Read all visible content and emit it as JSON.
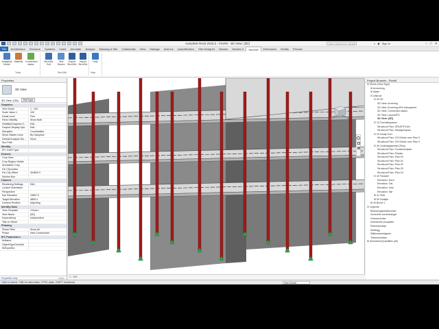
{
  "window": {
    "title": "Autodesk Revit 2018.2 - Fire#6 - 3D View: {3D}",
    "search_placeholder": "Type a keyword or phrase",
    "user": "Sign In",
    "controls": [
      "–",
      "□",
      "✕"
    ]
  },
  "tabs": [
    "File",
    "Architecture",
    "Structure",
    "Systems",
    "Insert",
    "Annotate",
    "Analyze",
    "Massing & Site",
    "Collaborate",
    "View",
    "Manage",
    "Add-Ins",
    "Quantification",
    "Site Designer",
    "Navisto",
    "Navisto 3",
    "StruSoft",
    "Extensions",
    "Modify",
    "Precast"
  ],
  "active_tab": "StruSoft",
  "ribbon": {
    "buttons": [
      {
        "label": "Analytical Model",
        "icon": "analytical-model-icon",
        "color": "#4a7fc1"
      },
      {
        "label": "Material",
        "icon": "material-icon",
        "color": "#c97a3a"
      },
      {
        "label": "Connection status",
        "icon": "connection-status-icon",
        "color": "#6aa84f"
      },
      {
        "label": "StruXML Exit",
        "icon": "struxml-exit-icon",
        "color": "#3d6fb0"
      },
      {
        "label": "Grid Search",
        "icon": "grid-search-icon",
        "color": "#5b8fd0"
      },
      {
        "label": "Export StruXML",
        "icon": "export-struxml-icon",
        "color": "#2f5f9e"
      },
      {
        "label": "Import StruXML",
        "icon": "import-struxml-icon",
        "color": "#2f5f9e"
      },
      {
        "label": "Help",
        "icon": "help-icon",
        "color": "#3b78c4"
      }
    ],
    "panels": [
      "Tools",
      "StruXML",
      "Help"
    ]
  },
  "properties": {
    "title": "Properties",
    "type_name": "3D View",
    "filter_value": "3D View: {3D}",
    "edit_type": "Edit Type",
    "groups": [
      {
        "name": "Graphics",
        "rows": [
          [
            "View Scale",
            "1 : 100"
          ],
          [
            "Scale Value  1:",
            "100"
          ],
          [
            "Detail Level",
            "Fine"
          ],
          [
            "Parts Visibility",
            "Show Both"
          ],
          [
            "Visibility/Graphics O...",
            "Edit..."
          ],
          [
            "Graphic Display Opti...",
            "Edit..."
          ],
          [
            "Discipline",
            "Coordination"
          ],
          [
            "Show Hidden Lines",
            "By Discipline"
          ],
          [
            "Default Analysis Dis...",
            "None"
          ],
          [
            "Sun Path",
            ""
          ]
        ]
      },
      {
        "name": "Identity",
        "rows": [
          [
            "IFC GUID Type",
            ""
          ]
        ]
      },
      {
        "name": "Extents",
        "rows": [
          [
            "Crop View",
            ""
          ],
          [
            "Crop Region Visible",
            ""
          ],
          [
            "Annotation Crop",
            ""
          ],
          [
            "Far Clip Active",
            ""
          ],
          [
            "Far Clip Offset",
            "304800.0"
          ],
          [
            "Section Box",
            ""
          ]
        ]
      },
      {
        "name": "Camera",
        "rows": [
          [
            "Rendering Settings",
            "Edit..."
          ],
          [
            "Locked Orientation",
            ""
          ],
          [
            "Perspective",
            ""
          ],
          [
            "Eye Elevation",
            "15807.0"
          ],
          [
            "Target Elevation",
            "4850.4"
          ],
          [
            "Camera Position",
            "Adjusting"
          ]
        ]
      },
      {
        "name": "Identity Data",
        "rows": [
          [
            "View Template",
            "<None>"
          ],
          [
            "View Name",
            "{3D}"
          ],
          [
            "Dependency",
            "Independent"
          ],
          [
            "Title on Sheet",
            ""
          ]
        ]
      },
      {
        "name": "Phasing",
        "rows": [
          [
            "Phase Filter",
            "Show All"
          ],
          [
            "Phase",
            "New Construction"
          ]
        ]
      },
      {
        "name": "IFC Parameters",
        "rows": [
          [
            "IfcName",
            ""
          ],
          [
            "ObjectTypeOverride",
            ""
          ],
          [
            "IfcExportAs",
            ""
          ]
        ]
      }
    ],
    "help_link": "Properties help",
    "apply": "Apply"
  },
  "browser": {
    "title": "Project Browser - Fire#6",
    "items": [
      {
        "t": "⊟ Views (View Type)",
        "d": 0
      },
      {
        "t": "⊞ Avmerking",
        "d": 1
      },
      {
        "t": "⊞ Mater",
        "d": 1
      },
      {
        "t": "⊟ Utstruct",
        "d": 1
      },
      {
        "t": "⊟ 00 3D",
        "d": 2
      },
      {
        "t": "3D View: Armering",
        "d": 3
      },
      {
        "t": "3D View: Armering 60% transparent",
        "d": 3
      },
      {
        "t": "3D View: Connection status",
        "d": 3
      },
      {
        "t": "3D View: Layout3PC",
        "d": 3
      },
      {
        "t": "3D View: {3D}",
        "d": 3,
        "sel": true
      },
      {
        "t": "⊟ 10 Oversiktsplaner",
        "d": 2
      },
      {
        "t": "Structural Plan: GRUNTPLAN",
        "d": 3
      },
      {
        "t": "Structural Plan: Situasjonsplan",
        "d": 3
      },
      {
        "t": "⊟ 20 Detalj Over",
        "d": 2
      },
      {
        "t": "Structural Plan: 120 Dekke over Plan 0",
        "d": 3
      },
      {
        "t": "Structural Plan: 220 Dekke over Plan 0",
        "d": 3
      },
      {
        "t": "⊟ 30 Underlagsarbeid (Plan)",
        "d": 2
      },
      {
        "t": "Structural Plan: Fundamentplan",
        "d": 3
      },
      {
        "t": "Structural Plan: Pelplan",
        "d": 3
      },
      {
        "t": "Structural Plan: Plan 00",
        "d": 3
      },
      {
        "t": "Structural Plan: Plan 01",
        "d": 3
      },
      {
        "t": "Structural Plan: Plan 02",
        "d": 3
      },
      {
        "t": "Structural Plan: Plan 03",
        "d": 3
      },
      {
        "t": "Structural Plan: Plan 04",
        "d": 3
      },
      {
        "t": "⊟ 40 Fasader",
        "d": 2
      },
      {
        "t": "Elevation: Nord",
        "d": 3
      },
      {
        "t": "Elevation: Ost",
        "d": 3
      },
      {
        "t": "Elevation: Vest",
        "d": 3
      },
      {
        "t": "Elevation: Sør",
        "d": 3
      },
      {
        "t": "⊞ 41 Snitt",
        "d": 2
      },
      {
        "t": "⊞ 50 Detaljer",
        "d": 2
      },
      {
        "t": "⊞ Vil Burde 1",
        "d": 1
      },
      {
        "t": "⊟ Legends",
        "d": 0
      },
      {
        "t": "Belastningsbeskrivelser",
        "d": 1
      },
      {
        "t": "Generelle anmerkninger",
        "d": 1
      },
      {
        "t": "Grenseverdier",
        "d": 1
      },
      {
        "t": "Innledende prosjekter",
        "d": 1
      },
      {
        "t": "Pelbeskrivelse",
        "d": 1
      },
      {
        "t": "Skiltlegg",
        "d": 1
      },
      {
        "t": "Stålbeskrivelsjøner",
        "d": 1
      },
      {
        "t": "Trebeskrivelser",
        "d": 1
      },
      {
        "t": "⊞ Schedules/Quantities (all)",
        "d": 0
      }
    ]
  },
  "view_control": "1 : 100",
  "status": {
    "text": "Click to select, TAB for alternates, CTRL adds, SHIFT unselects.",
    "model": "Main Model"
  },
  "colors": {
    "column": "#9e1b1b",
    "slab_top": "#d9d9d9",
    "slab_edge": "#b5b5b5",
    "wall": "#6e6e6e",
    "support": "#1fa34a",
    "accent": "#2b6cb0"
  }
}
